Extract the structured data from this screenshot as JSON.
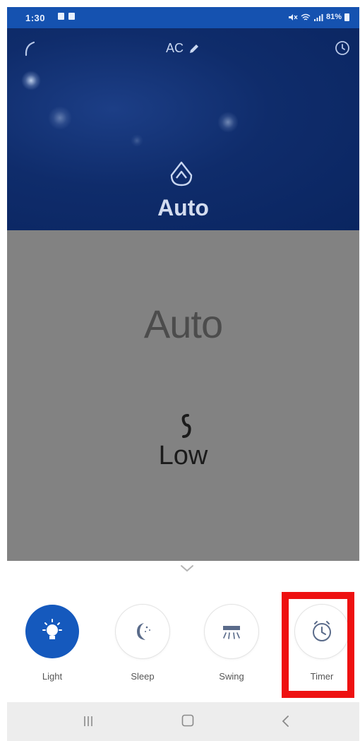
{
  "status_bar": {
    "time": "1:30",
    "battery": "81%"
  },
  "header": {
    "title": "AC",
    "back_icon": "back-arc-icon",
    "edit_icon": "pencil-icon",
    "timer_icon": "clock-icon"
  },
  "hero": {
    "mode_icon": "auto-mode-icon",
    "mode_label": "Auto"
  },
  "panel": {
    "mode_label": "Auto",
    "fan_icon": "fan-icon",
    "fan_speed": "Low"
  },
  "controls": {
    "expand_icon": "chevron-down-icon",
    "items": [
      {
        "label": "Light",
        "icon": "light-bulb-icon",
        "active": true
      },
      {
        "label": "Sleep",
        "icon": "moon-icon",
        "active": false
      },
      {
        "label": "Swing",
        "icon": "swing-icon",
        "active": false
      },
      {
        "label": "Timer",
        "icon": "clock-icon",
        "active": false,
        "highlighted": true
      }
    ]
  },
  "colors": {
    "status_bar": "#1552b0",
    "hero_bg": "#0f2c6b",
    "panel_bg": "#828282",
    "active_button": "#1559bd",
    "highlight": "#ee1111"
  },
  "nav_bar": {
    "recent_icon": "recent-apps-icon",
    "home_icon": "home-icon",
    "back_icon": "back-chevron-icon"
  }
}
